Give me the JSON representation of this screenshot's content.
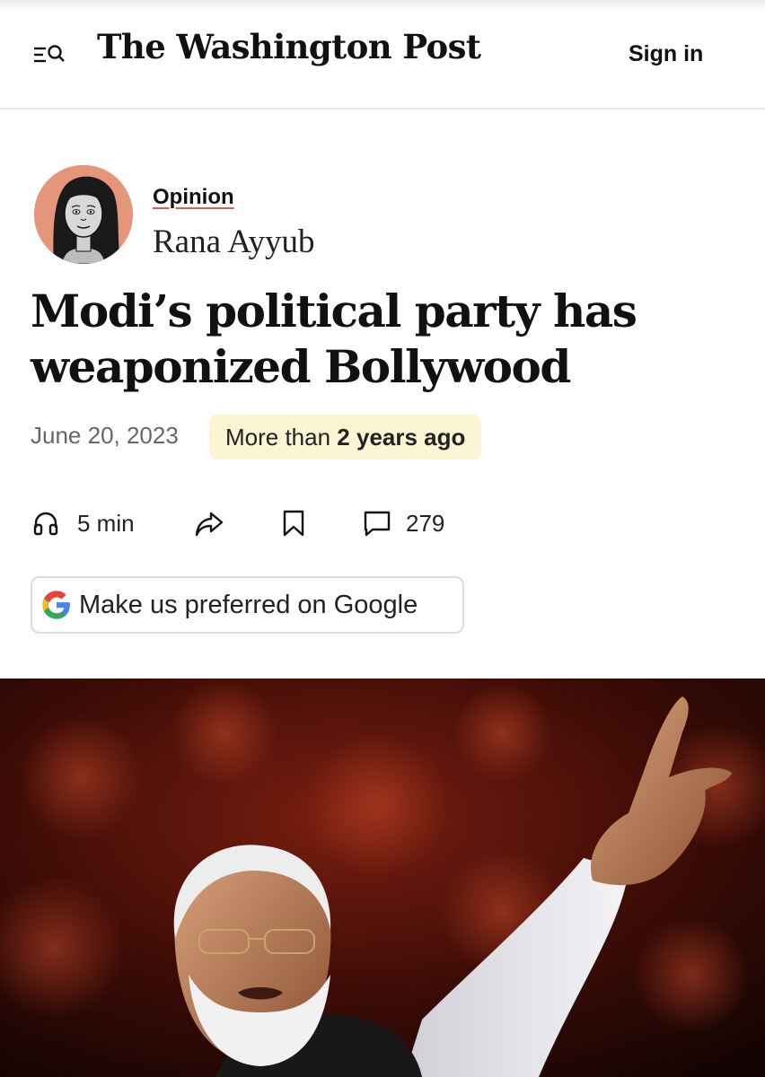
{
  "header": {
    "logo_text": "The Washington Post",
    "sign_in_label": "Sign in",
    "menu_icon": "menu-search-icon"
  },
  "article": {
    "section": "Opinion",
    "author": "Rana Ayyub",
    "headline_line1": "Modi’s political party has",
    "headline_line2": "weaponized Bollywood",
    "date": "June 20, 2023",
    "age_prefix": "More than ",
    "age_value": "2 years ago"
  },
  "actions": {
    "listen_label": "5 min",
    "comments_count": "279",
    "google_button_label": "Make us preferred on Google"
  },
  "colors": {
    "accent_underline": "#e0614a",
    "badge_background": "#fbf5d3",
    "avatar_background": "#e59579"
  }
}
